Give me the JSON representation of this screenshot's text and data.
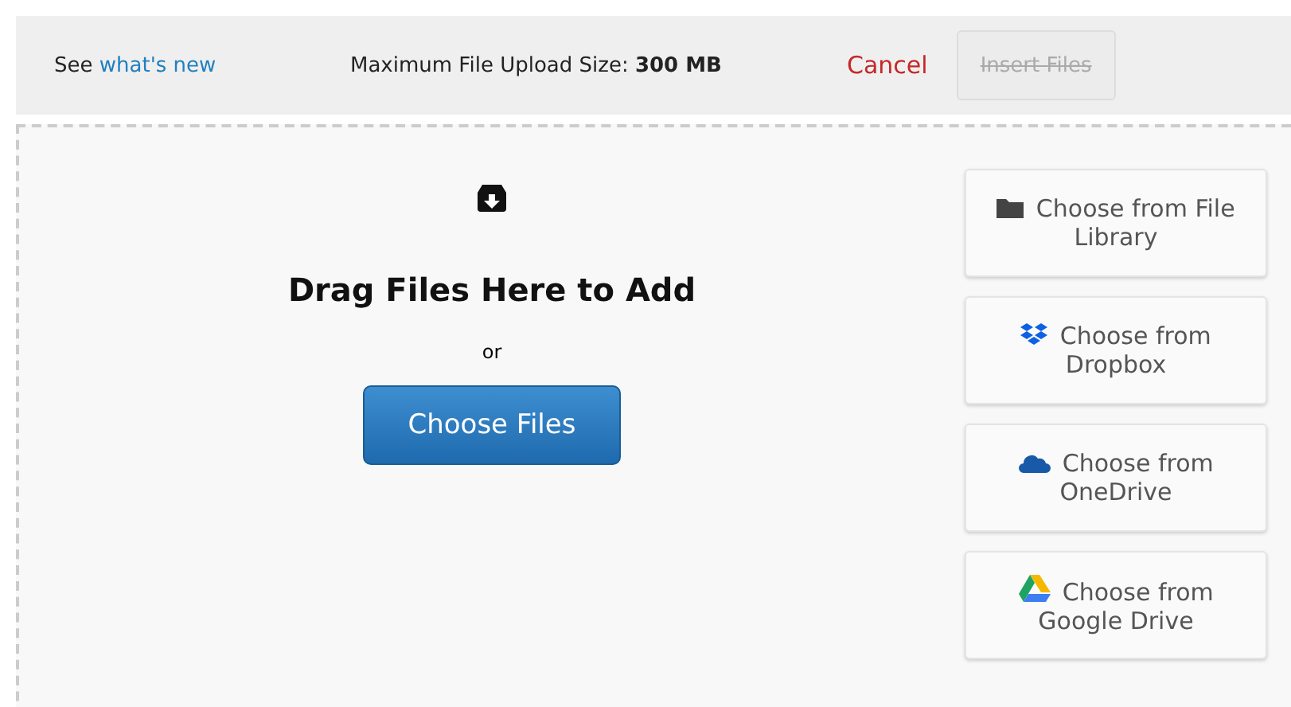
{
  "header": {
    "see_prefix": "See",
    "whats_new_link": "what's new",
    "max_size_label": "Maximum File Upload Size:",
    "max_size_value": "300 MB",
    "cancel": "Cancel",
    "insert": {
      "label": "Insert Files",
      "disabled": true
    }
  },
  "dropzone": {
    "title": "Drag Files Here to Add",
    "or": "or",
    "choose_button": "Choose Files"
  },
  "sources": [
    {
      "kind": "library",
      "label": "Choose from File Library"
    },
    {
      "kind": "dropbox",
      "label": "Choose from Dropbox"
    },
    {
      "kind": "onedrive",
      "label": "Choose from OneDrive"
    },
    {
      "kind": "gdrive",
      "label": "Choose from Google Drive"
    }
  ]
}
